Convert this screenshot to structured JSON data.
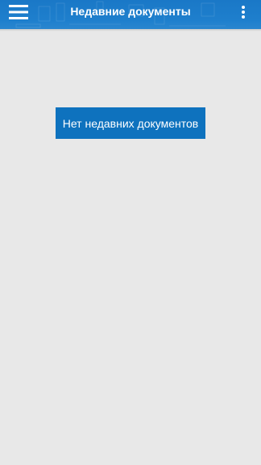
{
  "toolbar": {
    "title": "Недавние документы",
    "menu_icon": "hamburger-menu-icon",
    "overflow_icon": "more-vert-icon",
    "color": "#1e7fcd"
  },
  "main": {
    "empty_state_label": "Нет недавних документов",
    "background": "#e8e8e8",
    "button_color": "#0e72be"
  }
}
